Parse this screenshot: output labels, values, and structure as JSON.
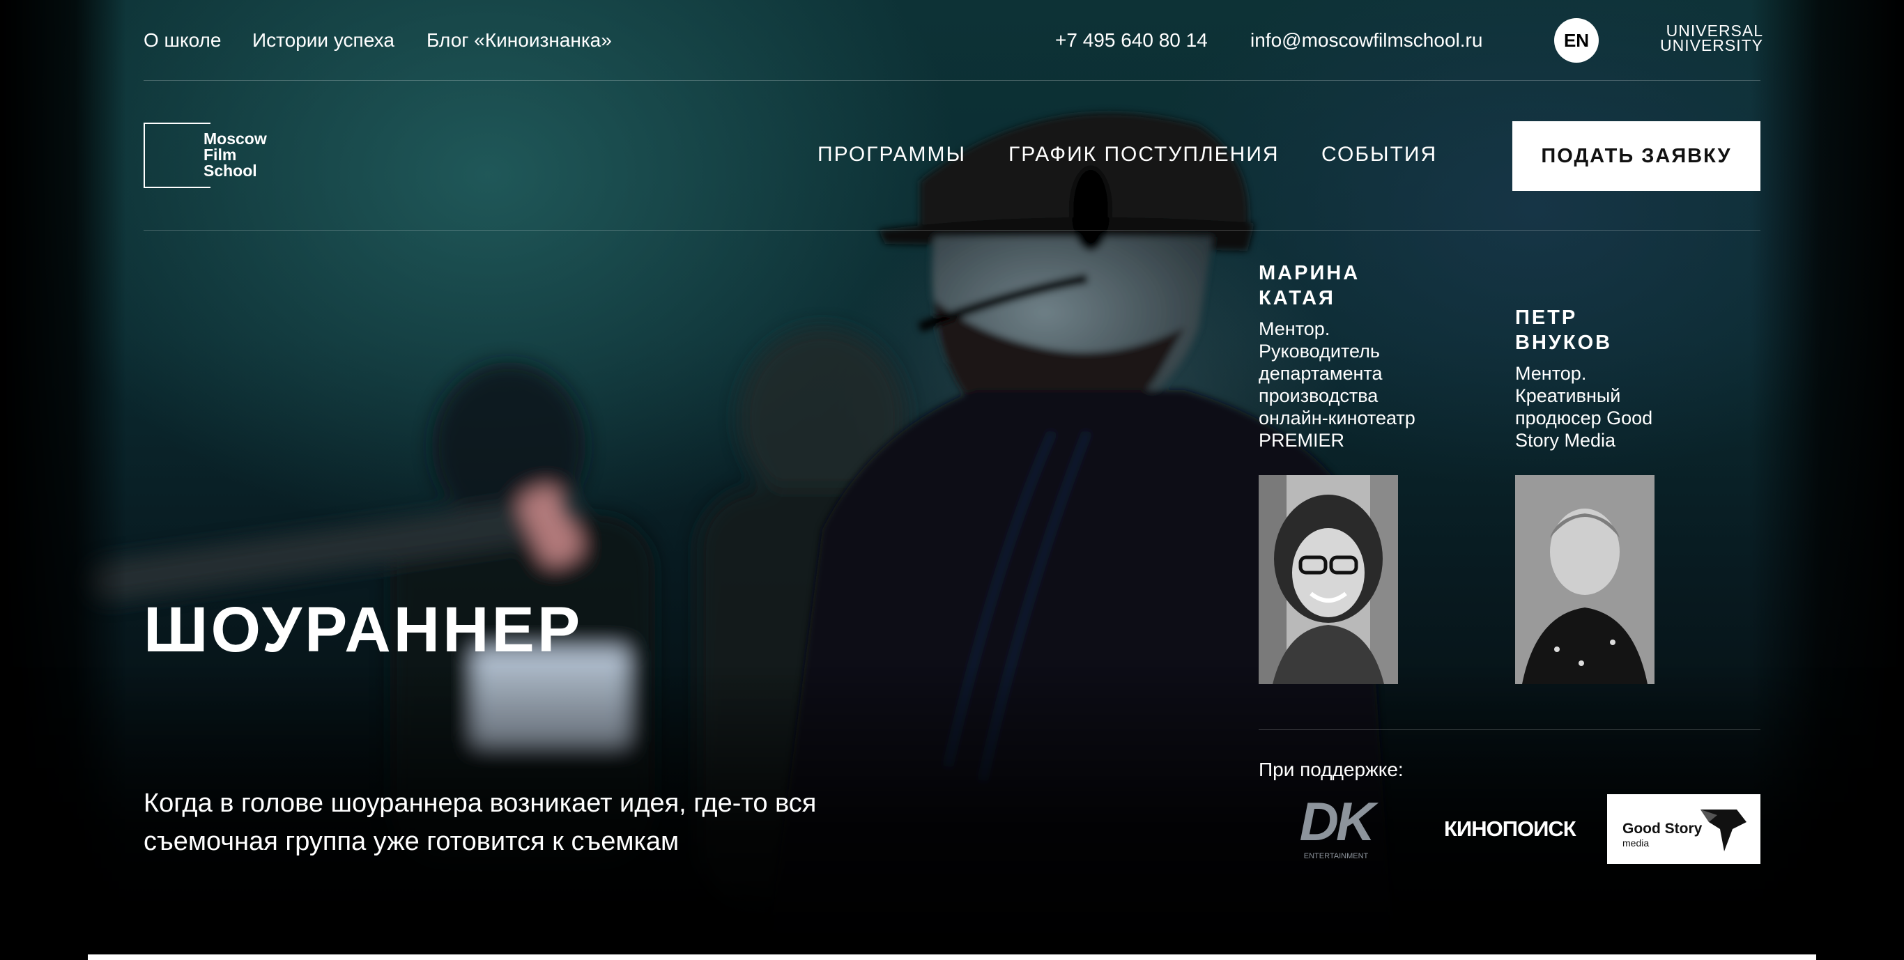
{
  "topbar": {
    "links": [
      "О школе",
      "Истории успеха",
      "Блог «Киноизнанка»"
    ],
    "phone": "+7 495 640 80 14",
    "email": "info@moscowfilmschool.ru",
    "lang": "EN",
    "partner_line1": "UNIVERSAL",
    "partner_line2": "UNIVERSITY"
  },
  "logo": {
    "line1": "Moscow",
    "line2": "Film",
    "line3": "School"
  },
  "nav": {
    "items": [
      "ПРОГРАММЫ",
      "ГРАФИК ПОСТУПЛЕНИЯ",
      "СОБЫТИЯ"
    ],
    "cta": "ПОДАТЬ ЗАЯВКУ"
  },
  "hero": {
    "title": "ШОУРАННЕР",
    "lead": "Когда в голове шоураннера возникает идея, где-то вся съемочная группа уже готовится к съемкам"
  },
  "mentors": [
    {
      "name_line1": "МАРИНА",
      "name_line2": "КАТАЯ",
      "desc": [
        "Ментор.",
        "Руководитель",
        "департамента",
        "производства",
        "онлайн-кинотеатр",
        "PREMIER"
      ]
    },
    {
      "name_line1": "ПЕТР",
      "name_line2": "ВНУКОВ",
      "desc": [
        "Ментор.",
        "Креативный",
        "продюсер Good",
        "Story Media"
      ]
    }
  ],
  "support": {
    "label": "При поддержке:",
    "sponsors": [
      {
        "logo_main": "DK",
        "logo_sub": "ENTERTAINMENT"
      },
      {
        "logo_main": "КИНОПОИСК"
      },
      {
        "logo_main": "Good Story",
        "logo_sub": "media"
      }
    ]
  },
  "colors": {
    "background": "#000000",
    "accent": "#ffffff",
    "hero_tint": "#0d3236"
  }
}
